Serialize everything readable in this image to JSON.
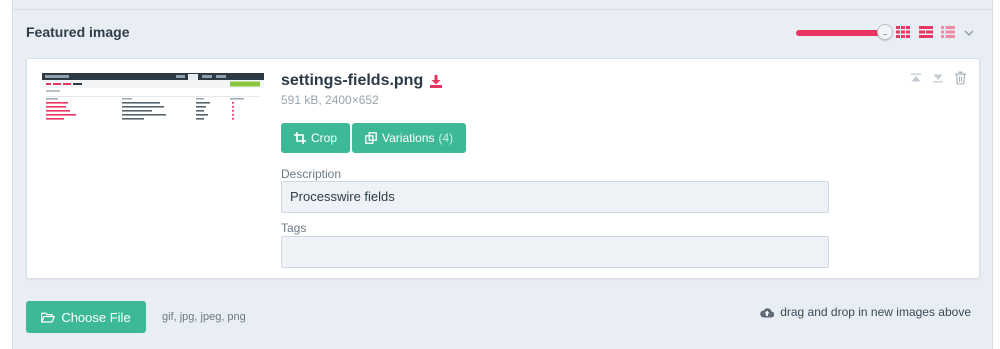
{
  "field": {
    "label": "Featured image",
    "accent_color": "#e83561",
    "button_color": "#3eb998",
    "thumbnail_size_level": 0.95,
    "view_icons": [
      "grid-view-icon",
      "proportional-view-icon",
      "list-view-icon"
    ],
    "toggle_icon": "chevron-down-icon"
  },
  "image": {
    "filename": "settings-fields.png",
    "meta": "591 kB, 2400×652",
    "thumbnail_alt": "Screenshot of Processwire fields settings page",
    "buttons": {
      "crop": "Crop",
      "variations": "Variations",
      "variations_count": "(4)"
    },
    "description_label": "Description",
    "description_value": "Processwire fields",
    "tags_label": "Tags",
    "tags_value": "",
    "tools": [
      "move-top-icon",
      "move-bottom-icon",
      "trash-icon"
    ]
  },
  "upload": {
    "choose_label": "Choose File",
    "types": "gif, jpg, jpeg, png",
    "drag_text": "drag and drop in new images above"
  }
}
